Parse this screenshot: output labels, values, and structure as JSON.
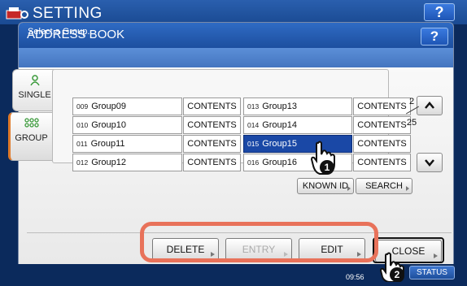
{
  "outer": {
    "title": "SETTING",
    "help_label": "?",
    "icon": "printer-setting-icon"
  },
  "dialog": {
    "title": "ADDRESS BOOK",
    "help_label": "?",
    "instruction": "Select a Group."
  },
  "tabs": [
    {
      "label": "SINGLE",
      "icon": "single-user-icon"
    },
    {
      "label": "GROUP",
      "icon": "group-users-icon",
      "active": true
    }
  ],
  "groups_left": [
    {
      "num": "009",
      "name": "Group09",
      "contents_label": "CONTENTS"
    },
    {
      "num": "010",
      "name": "Group10",
      "contents_label": "CONTENTS"
    },
    {
      "num": "011",
      "name": "Group11",
      "contents_label": "CONTENTS"
    },
    {
      "num": "012",
      "name": "Group12",
      "contents_label": "CONTENTS"
    }
  ],
  "groups_right": [
    {
      "num": "013",
      "name": "Group13",
      "contents_label": "CONTENTS"
    },
    {
      "num": "014",
      "name": "Group14",
      "contents_label": "CONTENTS"
    },
    {
      "num": "015",
      "name": "Group15",
      "contents_label": "CONTENTS",
      "selected": true
    },
    {
      "num": "016",
      "name": "Group16",
      "contents_label": "CONTENTS"
    }
  ],
  "pagination": {
    "current": "2",
    "total": "25"
  },
  "search_buttons": {
    "known_id": "KNOWN ID",
    "search": "SEARCH"
  },
  "actions": {
    "delete": "DELETE",
    "entry": "ENTRY",
    "edit": "EDIT",
    "close": "CLOSE"
  },
  "status_bar": {
    "time": "09:56",
    "status_label": "STATUS"
  },
  "callouts": {
    "step1": "1",
    "step2": "2"
  },
  "colors": {
    "highlight": "#e8725a",
    "selected_row": "#1a48a6",
    "header_blue": "#2f6bc4"
  }
}
